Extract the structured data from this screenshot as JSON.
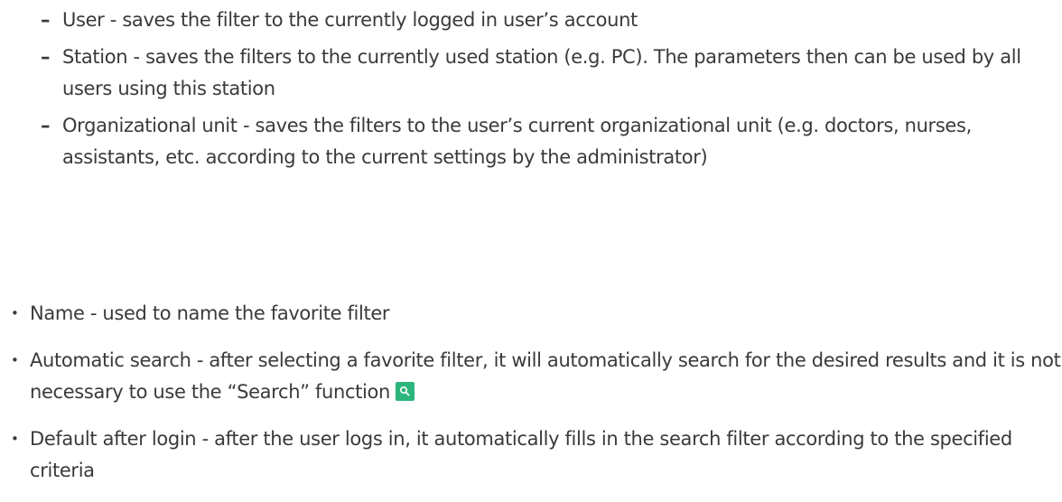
{
  "sub_items": [
    "User - saves the filter to the currently logged in user’s account",
    "Station - saves the filters to the currently used station (e.g. PC). The parameters then can be used by all users using this station",
    "Organizational unit - saves the filters to the user’s current organizational unit (e.g. doctors, nurses, assistants, etc. according to the current settings by the administrator)"
  ],
  "main_items": [
    "Name - used to name the favorite filter",
    "Automatic search - after selecting a favorite filter, it will automatically search for the desired results and it is not necessary to use the “Search” function",
    "Default after login - after the user logs in, it automatically fills in the search filter according to the specified criteria"
  ],
  "sub_marker": "–",
  "main_marker": "•",
  "icons": {
    "search": "search-icon",
    "search_color": "#2db67c"
  }
}
